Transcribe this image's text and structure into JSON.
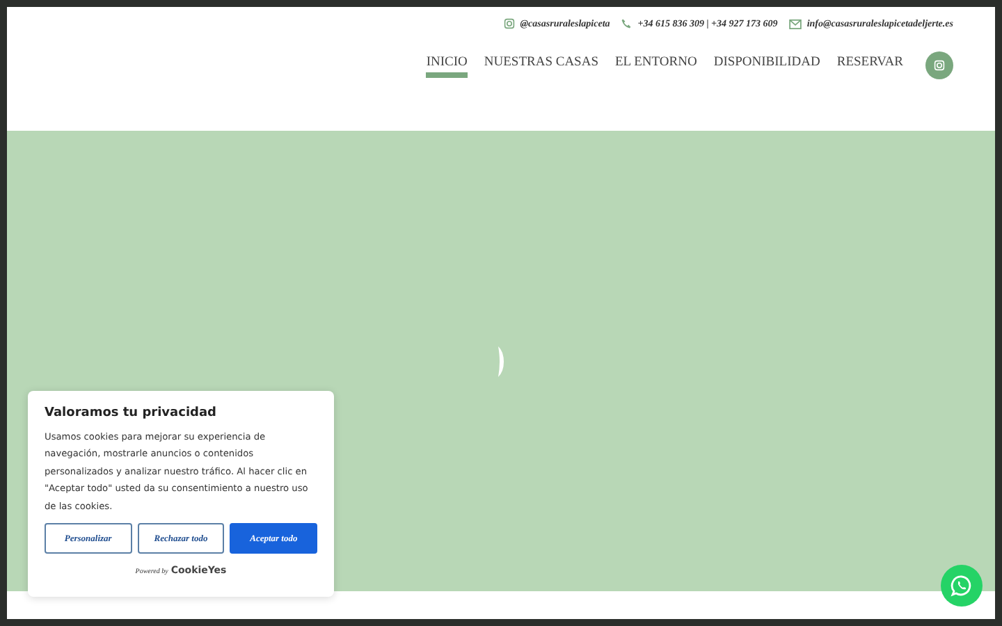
{
  "topbar": {
    "instagram": "@casasruraleslapiceta",
    "phone": "+34 615 836 309 | +34 927 173 609",
    "email": "info@casasruraleslapicetadeljerte.es"
  },
  "nav": [
    {
      "label": "INICIO",
      "selected": true
    },
    {
      "label": "NUESTRAS CASAS",
      "selected": false
    },
    {
      "label": "EL ENTORNO",
      "selected": false
    },
    {
      "label": "DISPONIBILIDAD",
      "selected": false
    },
    {
      "label": "RESERVAR",
      "selected": false
    }
  ],
  "cookie_banner": {
    "title": "Valoramos tu privacidad",
    "text": "Usamos cookies para mejorar su experiencia de navegación, mostrarle anuncios o contenidos personalizados y analizar nuestro tráfico. Al hacer clic en \"Aceptar todo\" usted da su consentimiento a nuestro uso de las cookies.",
    "buttons": [
      {
        "label": "Personalizar",
        "kind": "outline"
      },
      {
        "label": "Rechazar todo",
        "kind": "outline"
      },
      {
        "label": "Aceptar todo",
        "kind": "primary"
      }
    ],
    "powered_by": "Powered by",
    "brand": "CookieYes"
  }
}
